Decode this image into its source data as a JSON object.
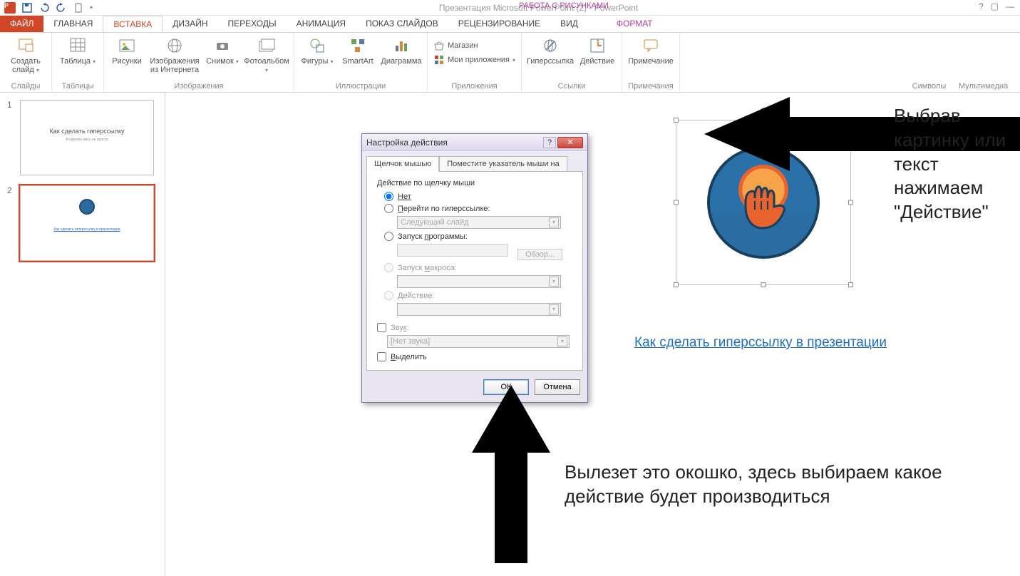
{
  "app": {
    "title": "Презентация Microsoft PowerPoint (2) - PowerPoint",
    "tools_context": "РАБОТА С РИСУНКАМИ"
  },
  "tabs": {
    "file": "ФАЙЛ",
    "home": "ГЛАВНАЯ",
    "insert": "ВСТАВКА",
    "design": "ДИЗАЙН",
    "transitions": "ПЕРЕХОДЫ",
    "animation": "АНИМАЦИЯ",
    "slideshow": "ПОКАЗ СЛАЙДОВ",
    "review": "РЕЦЕНЗИРОВАНИЕ",
    "view": "ВИД",
    "format": "ФОРМАТ"
  },
  "ribbon": {
    "slides": {
      "new_slide": "Создать слайд",
      "group": "Слайды"
    },
    "tables": {
      "table": "Таблица",
      "group": "Таблицы"
    },
    "images": {
      "pictures": "Рисунки",
      "online": "Изображения из Интернета",
      "screenshot": "Снимок",
      "album": "Фотоальбом",
      "group": "Изображения"
    },
    "illustrations": {
      "shapes": "Фигуры",
      "smartart": "SmartArt",
      "chart": "Диаграмма",
      "group": "Иллюстрации"
    },
    "apps": {
      "store": "Магазин",
      "myapps": "Мои приложения",
      "group": "Приложения"
    },
    "links": {
      "hyperlink": "Гиперссылка",
      "action": "Действие",
      "group": "Ссылки"
    },
    "comments": {
      "comment": "Примечание",
      "group": "Примечания"
    },
    "symbols_group": "Символы",
    "media_group": "Мультимедиа"
  },
  "thumbs": {
    "s1": {
      "num": "1",
      "title": "Как сделать гиперссылку",
      "sub": "А сделать весь не просто"
    },
    "s2": {
      "num": "2",
      "link": "Как сделать гиперссылку в презентации"
    }
  },
  "slide": {
    "hyperlink_text": "Как сделать гиперссылку в презентации"
  },
  "dialog": {
    "title": "Настройка действия",
    "tab_click": "Щелчок мышью",
    "tab_hover": "Поместите указатель мыши на",
    "group_label": "Действие по щелчку мыши",
    "r_none": "Нет",
    "r_hyper": "Перейти по гиперссылке:",
    "combo_hyper": "Следующий слайд",
    "r_run": "Запуск программы:",
    "btn_browse": "Обзор...",
    "r_macro": "Запуск макроса:",
    "r_action": "Действие:",
    "chk_sound": "Звук:",
    "combo_sound": "[Нет звука]",
    "chk_highlight": "Выделить",
    "ok": "ОК",
    "cancel": "Отмена"
  },
  "annot": {
    "a1": "Выбрав картинку или текст нажимаем \"Действие\"",
    "a2": "Вылезет это окошко, здесь выбираем какое действие будет производиться"
  }
}
